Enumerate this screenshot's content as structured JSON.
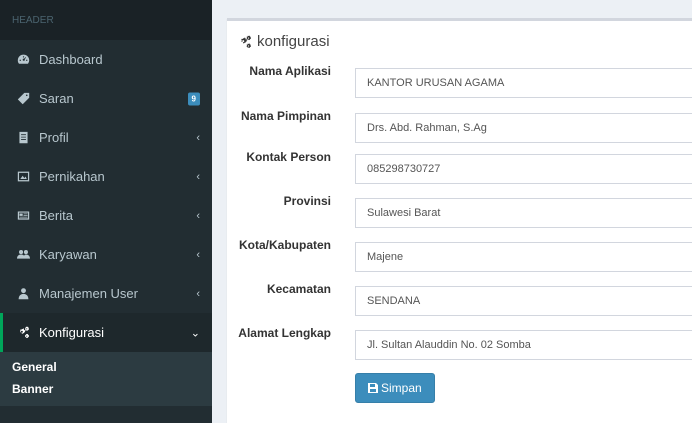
{
  "sidebar": {
    "header": "HEADER",
    "items": [
      {
        "label": "Dashboard",
        "icon": "dashboard-icon"
      },
      {
        "label": "Saran",
        "icon": "tag-icon",
        "badge": "9"
      },
      {
        "label": "Profil",
        "icon": "book-icon"
      },
      {
        "label": "Pernikahan",
        "icon": "image-icon"
      },
      {
        "label": "Berita",
        "icon": "newspaper-icon"
      },
      {
        "label": "Karyawan",
        "icon": "users-icon"
      },
      {
        "label": "Manajemen User",
        "icon": "user-icon"
      },
      {
        "label": "Konfigurasi",
        "icon": "cogs-icon"
      }
    ],
    "submenu": [
      "General",
      "Banner"
    ]
  },
  "panel": {
    "title": "konfigurasi",
    "fields": [
      {
        "label": "Nama Aplikasi",
        "value": "KANTOR URUSAN AGAMA"
      },
      {
        "label": "Nama Pimpinan",
        "value": "Drs. Abd. Rahman, S.Ag"
      },
      {
        "label": "Kontak Person",
        "value": "085298730727"
      },
      {
        "label": "Provinsi",
        "value": "Sulawesi Barat"
      },
      {
        "label": "Kota/Kabupaten",
        "value": "Majene"
      },
      {
        "label": "Kecamatan",
        "value": "SENDANA"
      },
      {
        "label": "Alamat Lengkap",
        "value": "Jl. Sultan Alauddin No. 02 Somba"
      }
    ],
    "save_label": "Simpan"
  },
  "colors": {
    "sidebar_bg": "#222d32",
    "active_border": "#00a65a",
    "primary": "#3c8dbc"
  }
}
